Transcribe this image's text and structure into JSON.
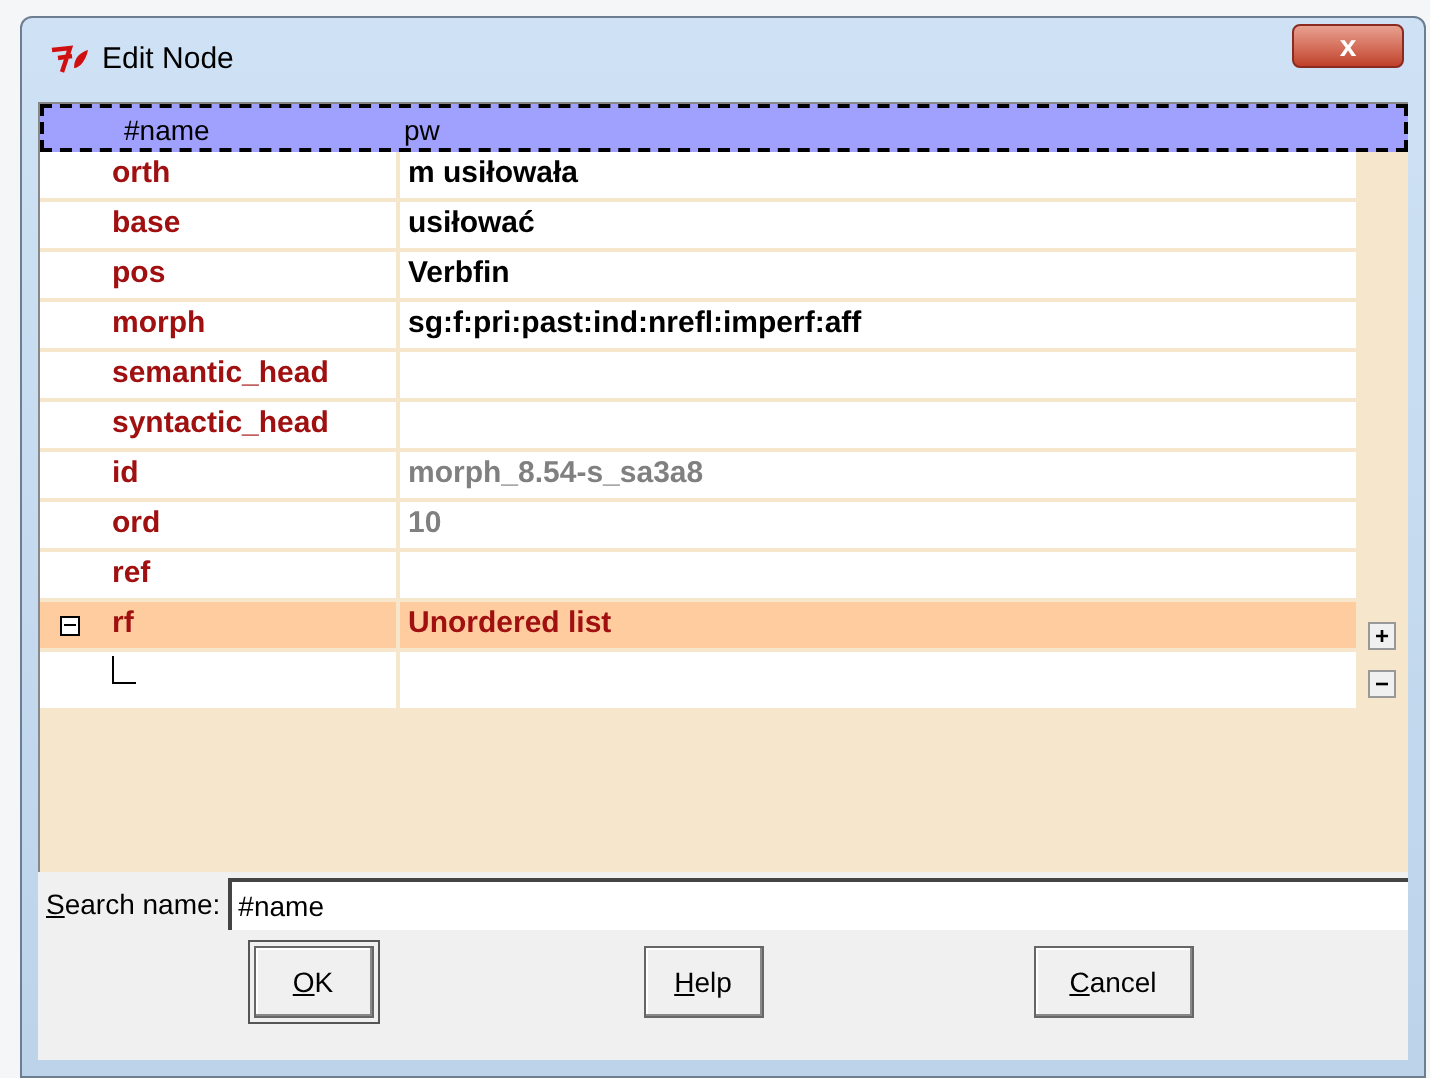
{
  "window": {
    "title": "Edit Node",
    "close": "x"
  },
  "header": {
    "name": "#name",
    "value": "pw",
    "selected": true
  },
  "rows": [
    {
      "name": "orth",
      "value": "m usiłowała",
      "kind": "text",
      "selected": false
    },
    {
      "name": "base",
      "value": "usiłować",
      "kind": "text",
      "selected": false
    },
    {
      "name": "pos",
      "value": "Verbfin",
      "kind": "text",
      "selected": false
    },
    {
      "name": "morph",
      "value": "sg:f:pri:past:ind:nrefl:imperf:aff",
      "kind": "text",
      "selected": false
    },
    {
      "name": "semantic_head",
      "kind": "text",
      "selected": false
    },
    {
      "name": "syntactic_head",
      "kind": "text",
      "selected": false
    },
    {
      "name": "id",
      "value": "morph_8.54-s_sa3a8",
      "kind": "readonly",
      "selected": false
    },
    {
      "name": "ord",
      "value": "10",
      "kind": "readonly",
      "selected": false
    },
    {
      "name": "ref",
      "kind": "text",
      "selected": false
    },
    {
      "name": "rf",
      "value": "Unordered list",
      "kind": "list",
      "selected": true,
      "expanded": true,
      "children": [
        {
          "kind": "empty",
          "selected": false
        }
      ]
    }
  ],
  "side_buttons": [
    "+",
    "−"
  ],
  "search": {
    "label": "Search name:",
    "value": "#name",
    "mnemonic": true
  },
  "buttons": [
    {
      "label": "OK",
      "default": true,
      "mnemonic": true
    },
    {
      "label": "Help",
      "default": false,
      "mnemonic": true
    },
    {
      "label": "Cancel",
      "default": false,
      "mnemonic": true
    }
  ]
}
